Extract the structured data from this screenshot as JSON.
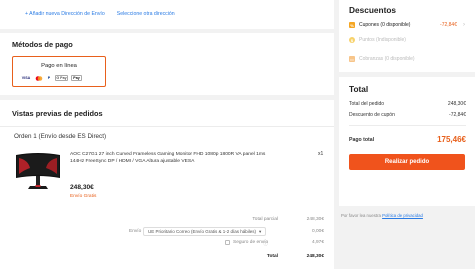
{
  "address_links": {
    "add_eu": "+ Añadir nueva Dirección de Envío",
    "select_another": "Seleccione otra dirección"
  },
  "payment": {
    "title": "Métodos de pago",
    "option_label": "Pago en línea",
    "logos": [
      "VISA",
      "Mastercard",
      "PayPal",
      "G Pay",
      "Apple Pay"
    ],
    "logo_texts": [
      "VISA",
      "",
      "P",
      "G Pay",
      "Pay"
    ]
  },
  "orders": {
    "title": "Vistas previas de pedidos",
    "order_title": "Orden 1 (Envío desde ES Direct)",
    "product_name": "AOC C27G1 27 inch Curved Frameless Gaming Monitor FHD 1080p 1800R VA panel 1ms 144Hz FreeSync DP / HDMI / VGA Altura ajustable VESA",
    "qty": "x1",
    "price": "248,30€",
    "shipping_note": "Envío Gratis",
    "subtotal_label": "Total parcial",
    "subtotal_value": "248,30€",
    "shipping_label": "Envío",
    "shipping_select": "UE Prioritario Correo (Envío Gratis & 1-2 días hábiles)",
    "shipping_value": "0,00€",
    "insurance_label": "Seguro de envío",
    "insurance_value": "4,97€",
    "total_label": "Total",
    "total_value": "248,30€"
  },
  "discounts": {
    "title": "Descuentos",
    "coupons": "Cupones (0 disponible)",
    "coupons_value": "-72,84€",
    "points": "Puntos (Indisponible)",
    "gift_card": "Cobranzas (0 disponible)"
  },
  "total": {
    "title": "Total",
    "order_total_label": "Total del pedido",
    "order_total_value": "248,30€",
    "coupon_discount_label": "Descuento de cupón",
    "coupon_discount_value": "-72,84€",
    "pay_total_label": "Pago total",
    "pay_total_value": "175,46€",
    "button_label": "Realizar pedido"
  },
  "privacy": {
    "prefix": "Por favor lea nuestra",
    "link": "Política de privacidad"
  },
  "colors": {
    "accent": "#f0531c",
    "link": "#2a7be4"
  }
}
